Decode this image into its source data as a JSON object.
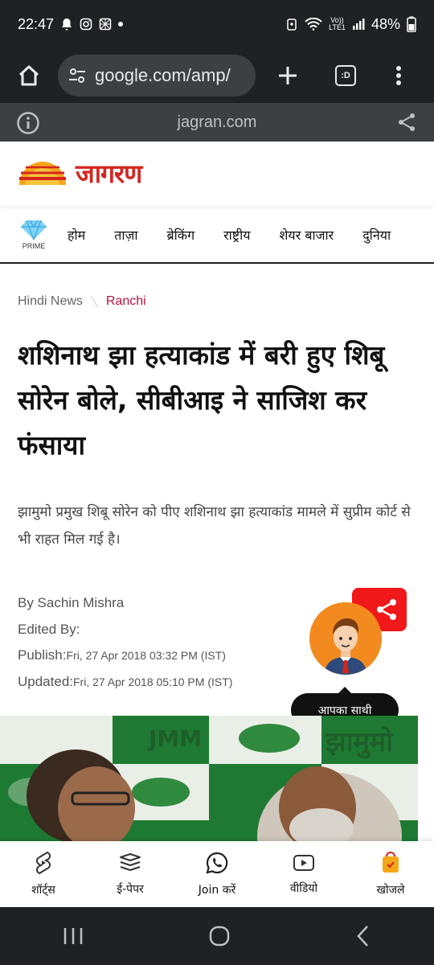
{
  "status": {
    "time": "22:47",
    "battery": "48%",
    "network": "LTE1"
  },
  "browser": {
    "url": "google.com/amp/",
    "tabs_label": ":D",
    "amp_domain": "jagran.com"
  },
  "site": {
    "logo_text": "जागरण",
    "logo_colors": {
      "sun": "#f5a71a",
      "stripe": "#d3261f",
      "text": "#d3261f"
    }
  },
  "nav": {
    "prime_label": "PRIME",
    "items": [
      "होम",
      "ताज़ा",
      "ब्रेकिंग",
      "राष्ट्रीय",
      "शेयर बाजार",
      "दुनिया"
    ]
  },
  "breadcrumb": {
    "home": "Hindi News",
    "current": "Ranchi"
  },
  "article": {
    "headline": "शशिनाथ झा हत्याकांड में बरी हुए शिबू सोरेन बोले, सीबीआइ ने साजिश कर फंसाया",
    "summary": "झामुमो प्रमुख शिबू सोरेन को पीए शशिनाथ झा हत्याकांड मामले में सुप्रीम कोर्ट से भी राहत मिल गई है।",
    "author": "By Sachin Mishra",
    "edited_by": "Edited By:",
    "publish_label": "Publish:",
    "publish_date": "Fri, 27 Apr 2018 03:32 PM (IST)",
    "updated_label": "Updated:",
    "updated_date": "Fri, 27 Apr 2018 05:10 PM (IST)",
    "image_text": [
      "JMM",
      "झामुमो"
    ]
  },
  "assistant": {
    "tooltip": "आपका साथी"
  },
  "bottom_nav": [
    "शॉर्ट्स",
    "ई-पेपर",
    "Join करें",
    "वीडियो",
    "खोजले"
  ],
  "colors": {
    "accent_red": "#d3261f",
    "share_red": "#f01818",
    "breadcrumb_current": "#b8123e",
    "chrome_dark": "#202124"
  }
}
